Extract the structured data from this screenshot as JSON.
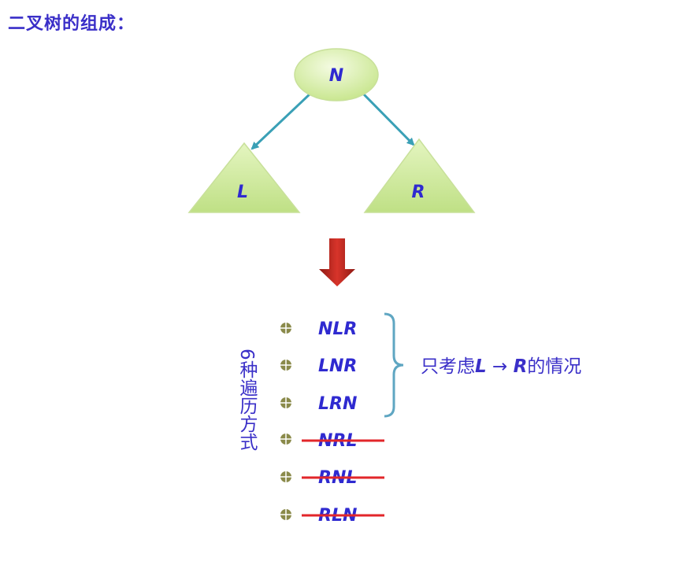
{
  "title": "二叉树的组成：",
  "tree": {
    "root": "N",
    "left": "L",
    "right": "R"
  },
  "side_label": "6种遍历方式",
  "orders": [
    {
      "label": "NLR",
      "struck": false
    },
    {
      "label": "LNR",
      "struck": false
    },
    {
      "label": "LRN",
      "struck": false
    },
    {
      "label": "NRL",
      "struck": true
    },
    {
      "label": "RNL",
      "struck": true
    },
    {
      "label": "RLN",
      "struck": true
    }
  ],
  "note": {
    "prefix": "只考虑",
    "from": "L",
    "arrow": "→",
    "to": "R",
    "suffix": "的情况"
  },
  "colors": {
    "text": "#3a2fc8",
    "node_fill": "#d9f0a8",
    "edge": "#3aa0b6",
    "down_arrow": "#c0271e",
    "strike": "#e2262a",
    "brace": "#5fa6c2",
    "bullet": "#7a7a3a"
  }
}
